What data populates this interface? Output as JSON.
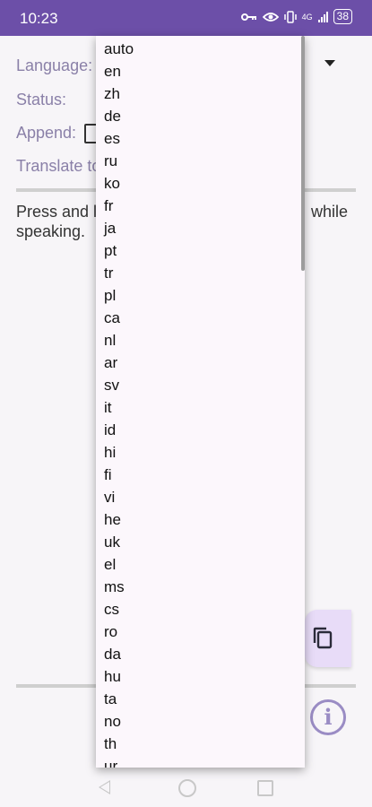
{
  "statusbar": {
    "time": "10:23",
    "network": "4G",
    "battery": "38",
    "icons": [
      "key-icon",
      "eye-icon",
      "vibrate-icon",
      "signal-icon",
      "battery-icon"
    ]
  },
  "form": {
    "language_label": "Language:",
    "status_label": "Status:",
    "append_label": "Append:",
    "translate_label": "Translate to"
  },
  "instructions": {
    "line1_left": "Press and l",
    "line1_right": "while",
    "line2": "speaking."
  },
  "language_menu": {
    "options": [
      "auto",
      "en",
      "zh",
      "de",
      "es",
      "ru",
      "ko",
      "fr",
      "ja",
      "pt",
      "tr",
      "pl",
      "ca",
      "nl",
      "ar",
      "sv",
      "it",
      "id",
      "hi",
      "fi",
      "vi",
      "he",
      "uk",
      "el",
      "ms",
      "cs",
      "ro",
      "da",
      "hu",
      "ta",
      "no",
      "th",
      "ur"
    ]
  },
  "colors": {
    "status_bar": "#6c4fa8",
    "label_text": "#8a80a8",
    "menu_background": "#fcf7fc",
    "fab_background": "#e8dcf8",
    "info_icon": "#9a8cc4"
  }
}
